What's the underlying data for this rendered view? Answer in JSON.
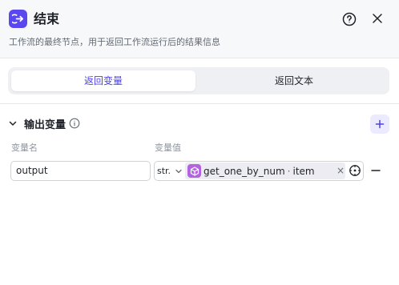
{
  "header": {
    "title": "结束",
    "description": "工作流的最终节点，用于返回工作流运行后的结果信息",
    "node_icon": "exit-node-icon",
    "help_icon": "question-circle-icon",
    "close_icon": "close-icon"
  },
  "tabs": [
    {
      "label": "返回变量",
      "active": true
    },
    {
      "label": "返回文本",
      "active": false
    }
  ],
  "output_section": {
    "title": "输出变量",
    "info_icon": "info-icon",
    "add_icon": "plus-icon",
    "columns": {
      "name": "变量名",
      "value": "变量值"
    },
    "rows": [
      {
        "name": "output",
        "type": "str.",
        "ref_node": "get_one_by_num",
        "ref_sep": "·",
        "ref_var": "item",
        "clear": "×"
      }
    ]
  },
  "colors": {
    "accent": "#4e40e5",
    "node_icon_bg": "#5b47f0",
    "ref_icon_bg": "#b163e0",
    "header_bg": "#f7f8fa"
  }
}
